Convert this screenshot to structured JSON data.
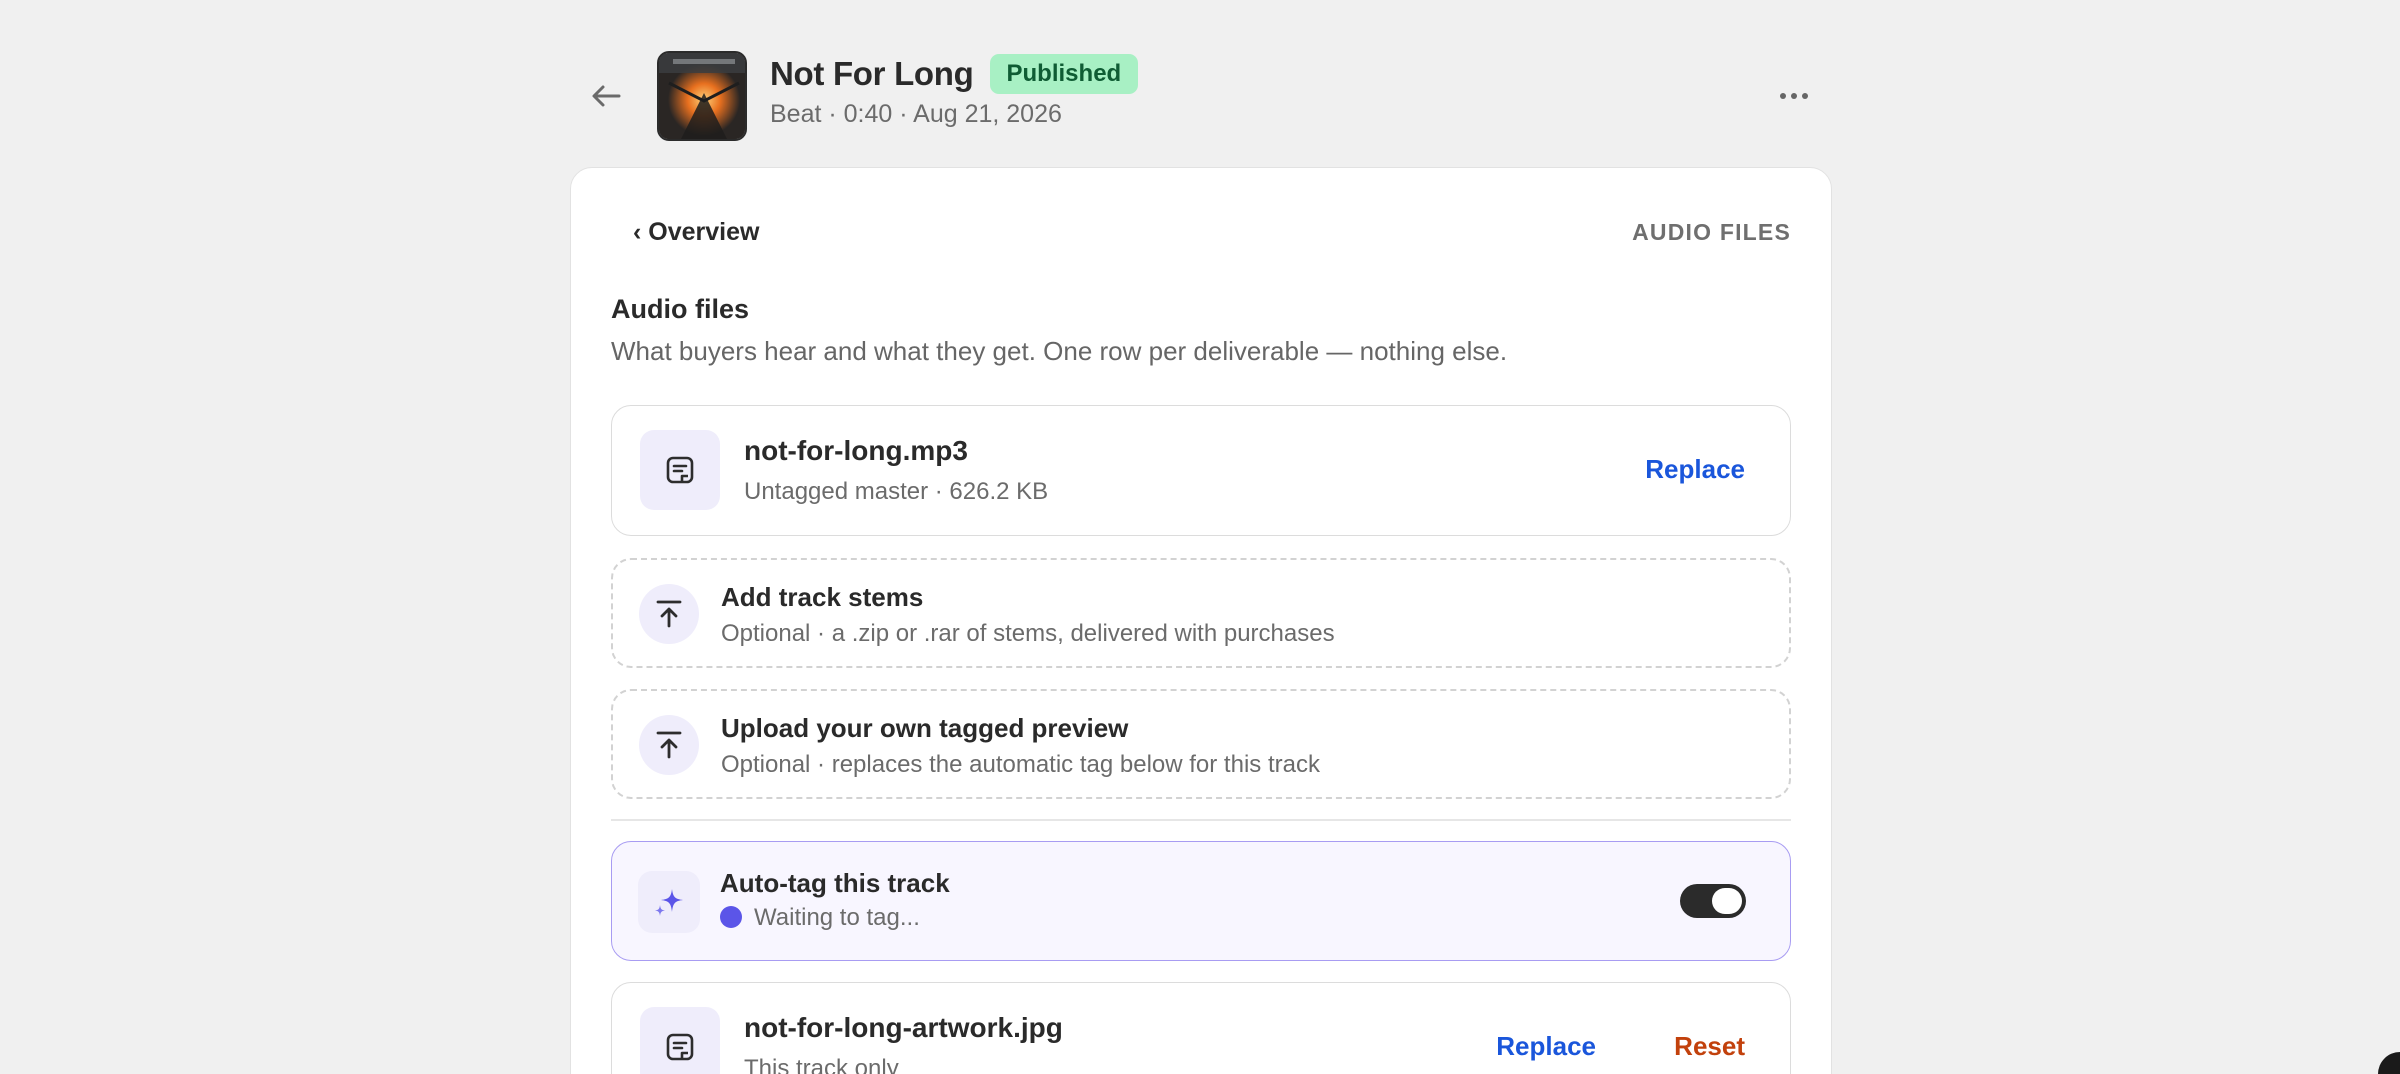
{
  "header": {
    "title": "Not For Long",
    "status_badge": "Published",
    "meta": "Beat · 0:40 · Aug 21, 2026"
  },
  "nav": {
    "breadcrumb": "‹ Overview",
    "section_label": "AUDIO FILES"
  },
  "section": {
    "title": "Audio files",
    "description": "What buyers hear and what they get. One row per deliverable — nothing else."
  },
  "master_file": {
    "name": "not-for-long.mp3",
    "details": "Untagged master · 626.2 KB",
    "replace_label": "Replace",
    "icon": "file-audio-icon"
  },
  "stems_upload": {
    "title": "Add track stems",
    "subtitle": "Optional · a .zip or .rar of stems, delivered with purchases",
    "icon": "upload-icon"
  },
  "preview_upload": {
    "title": "Upload your own tagged preview",
    "subtitle": "Optional · replaces the automatic tag below for this track",
    "icon": "upload-icon"
  },
  "auto_tag": {
    "title": "Auto-tag this track",
    "status": "Waiting to tag...",
    "enabled": true,
    "icon": "sparkle-icon"
  },
  "artwork_file": {
    "name": "not-for-long-artwork.jpg",
    "details": "This track only",
    "replace_label": "Replace",
    "reset_label": "Reset",
    "icon": "file-icon"
  },
  "colors": {
    "accent": "#5b55e8",
    "link": "#1a56db",
    "danger": "#c2410c",
    "published_bg": "#a8f0c4",
    "published_text": "#0f5c34"
  }
}
